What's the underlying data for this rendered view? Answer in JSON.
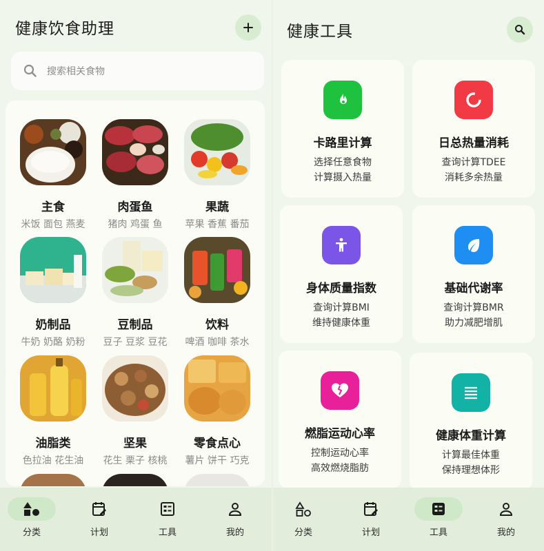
{
  "left": {
    "title": "健康饮食助理",
    "add_icon": "plus-icon",
    "search": {
      "placeholder": "搜索相关食物",
      "icon": "search-icon"
    },
    "categories": [
      {
        "name": "主食",
        "sub": "米饭 面包 燕麦"
      },
      {
        "name": "肉蛋鱼",
        "sub": "猪肉 鸡蛋 鱼"
      },
      {
        "name": "果蔬",
        "sub": "苹果 香蕉 番茄"
      },
      {
        "name": "奶制品",
        "sub": "牛奶 奶酪 奶粉"
      },
      {
        "name": "豆制品",
        "sub": "豆子 豆浆 豆花"
      },
      {
        "name": "饮料",
        "sub": "啤酒 咖啡 茶水"
      },
      {
        "name": "油脂类",
        "sub": "色拉油 花生油"
      },
      {
        "name": "坚果",
        "sub": "花生 栗子 核桃"
      },
      {
        "name": "零食点心",
        "sub": "薯片 饼干 巧克"
      }
    ],
    "nav": [
      {
        "label": "分类",
        "icon": "category-icon",
        "active": true
      },
      {
        "label": "计划",
        "icon": "calendar-edit-icon",
        "active": false
      },
      {
        "label": "工具",
        "icon": "tools-list-icon",
        "active": false
      },
      {
        "label": "我的",
        "icon": "person-icon",
        "active": false
      }
    ]
  },
  "right": {
    "title": "健康工具",
    "search_icon": "search-icon",
    "tools": [
      {
        "title": "卡路里计算",
        "line1": "选择任意食物",
        "line2": "计算摄入热量",
        "color": "#1fc23f",
        "icon": "flame-icon"
      },
      {
        "title": "日总热量消耗",
        "line1": "查询计算TDEE",
        "line2": "消耗多余热量",
        "color": "#f23a45",
        "icon": "ring-icon"
      },
      {
        "title": "身体质量指数",
        "line1": "查询计算BMI",
        "line2": "维持健康体重",
        "color": "#7b55e8",
        "icon": "figure-icon"
      },
      {
        "title": "基础代谢率",
        "line1": "查询计算BMR",
        "line2": "助力减肥增肌",
        "color": "#1f8ef2",
        "icon": "leaf-icon"
      },
      {
        "title": "燃脂运动心率",
        "line1": "控制运动心率",
        "line2": "高效燃烧脂肪",
        "color": "#e8219a",
        "icon": "broken-heart-icon"
      },
      {
        "title": "健康体重计算",
        "line1": "计算最佳体重",
        "line2": "保持理想体形",
        "color": "#12b3a6",
        "icon": "lines-icon"
      }
    ],
    "nav": [
      {
        "label": "分类",
        "icon": "category-icon",
        "active": false
      },
      {
        "label": "计划",
        "icon": "calendar-edit-icon",
        "active": false
      },
      {
        "label": "工具",
        "icon": "tools-list-icon",
        "active": true
      },
      {
        "label": "我的",
        "icon": "person-icon",
        "active": false
      }
    ]
  }
}
